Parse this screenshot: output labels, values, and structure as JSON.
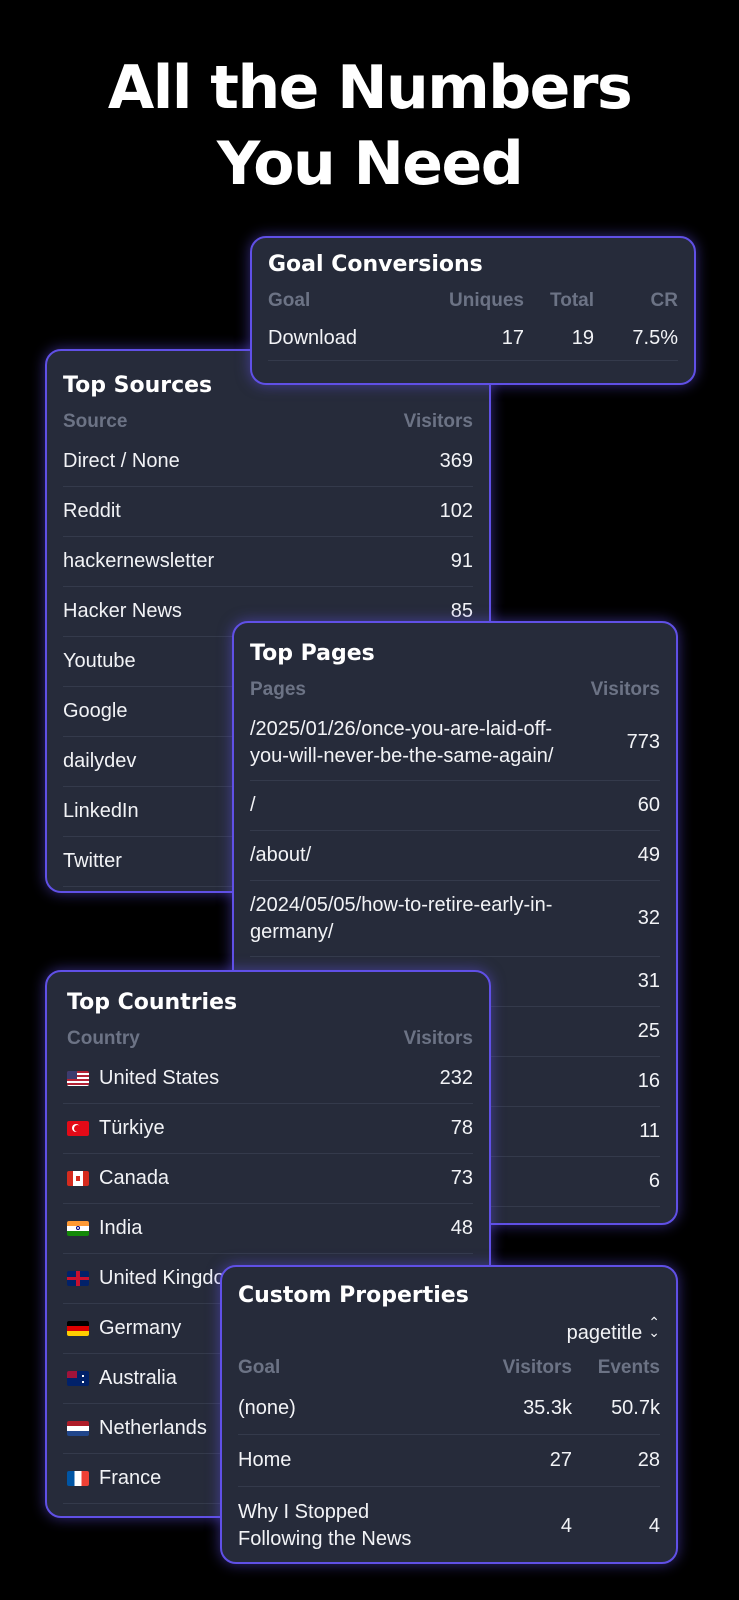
{
  "headline": {
    "line1": "All the Numbers",
    "line2": "You Need"
  },
  "goal_conversions": {
    "title": "Goal Conversions",
    "headers": {
      "goal": "Goal",
      "uniques": "Uniques",
      "total": "Total",
      "cr": "CR"
    },
    "rows": [
      {
        "goal": "Download",
        "uniques": "17",
        "total": "19",
        "cr": "7.5%"
      }
    ]
  },
  "top_sources": {
    "title": "Top Sources",
    "headers": {
      "source": "Source",
      "visitors": "Visitors"
    },
    "rows": [
      {
        "source": "Direct / None",
        "visitors": "369"
      },
      {
        "source": "Reddit",
        "visitors": "102"
      },
      {
        "source": "hackernewsletter",
        "visitors": "91"
      },
      {
        "source": "Hacker News",
        "visitors": "85"
      },
      {
        "source": "Youtube",
        "visitors": ""
      },
      {
        "source": "Google",
        "visitors": ""
      },
      {
        "source": "dailydev",
        "visitors": ""
      },
      {
        "source": "LinkedIn",
        "visitors": ""
      },
      {
        "source": "Twitter",
        "visitors": ""
      }
    ]
  },
  "top_pages": {
    "title": "Top Pages",
    "headers": {
      "pages": "Pages",
      "visitors": "Visitors"
    },
    "rows": [
      {
        "page": "/2025/01/26/once-you-are-laid-off-you-will-never-be-the-same-again/",
        "visitors": "773"
      },
      {
        "page": "/",
        "visitors": "60"
      },
      {
        "page": "/about/",
        "visitors": "49"
      },
      {
        "page": "/2024/05/05/how-to-retire-early-in-germany/",
        "visitors": "32"
      },
      {
        "page": "",
        "visitors": "31"
      },
      {
        "page": "",
        "visitors": "25"
      },
      {
        "page": "",
        "visitors": "16"
      },
      {
        "page": "",
        "visitors": "11"
      },
      {
        "page": "",
        "visitors": "6"
      }
    ]
  },
  "top_countries": {
    "title": "Top Countries",
    "headers": {
      "country": "Country",
      "visitors": "Visitors"
    },
    "rows": [
      {
        "country": "United States",
        "flag": "us-flag-icon",
        "visitors": "232"
      },
      {
        "country": "Türkiye",
        "flag": "tr-flag-icon",
        "visitors": "78"
      },
      {
        "country": "Canada",
        "flag": "ca-flag-icon",
        "visitors": "73"
      },
      {
        "country": "India",
        "flag": "in-flag-icon",
        "visitors": "48"
      },
      {
        "country": "United Kingdom",
        "flag": "gb-flag-icon",
        "visitors": ""
      },
      {
        "country": "Germany",
        "flag": "de-flag-icon",
        "visitors": ""
      },
      {
        "country": "Australia",
        "flag": "au-flag-icon",
        "visitors": ""
      },
      {
        "country": "Netherlands",
        "flag": "nl-flag-icon",
        "visitors": ""
      },
      {
        "country": "France",
        "flag": "fr-flag-icon",
        "visitors": ""
      }
    ]
  },
  "custom_properties": {
    "title": "Custom Properties",
    "selector": "pagetitle",
    "headers": {
      "goal": "Goal",
      "visitors": "Visitors",
      "events": "Events"
    },
    "rows": [
      {
        "goal": "(none)",
        "visitors": "35.3k",
        "events": "50.7k"
      },
      {
        "goal": "Home",
        "visitors": "27",
        "events": "28"
      },
      {
        "goal": "Why I Stopped Following the News",
        "visitors": "4",
        "events": "4"
      }
    ]
  },
  "colors": {
    "background": "#000000",
    "card": "#262b3a",
    "card_border": "#6050e6",
    "header_text": "#6c7385"
  }
}
